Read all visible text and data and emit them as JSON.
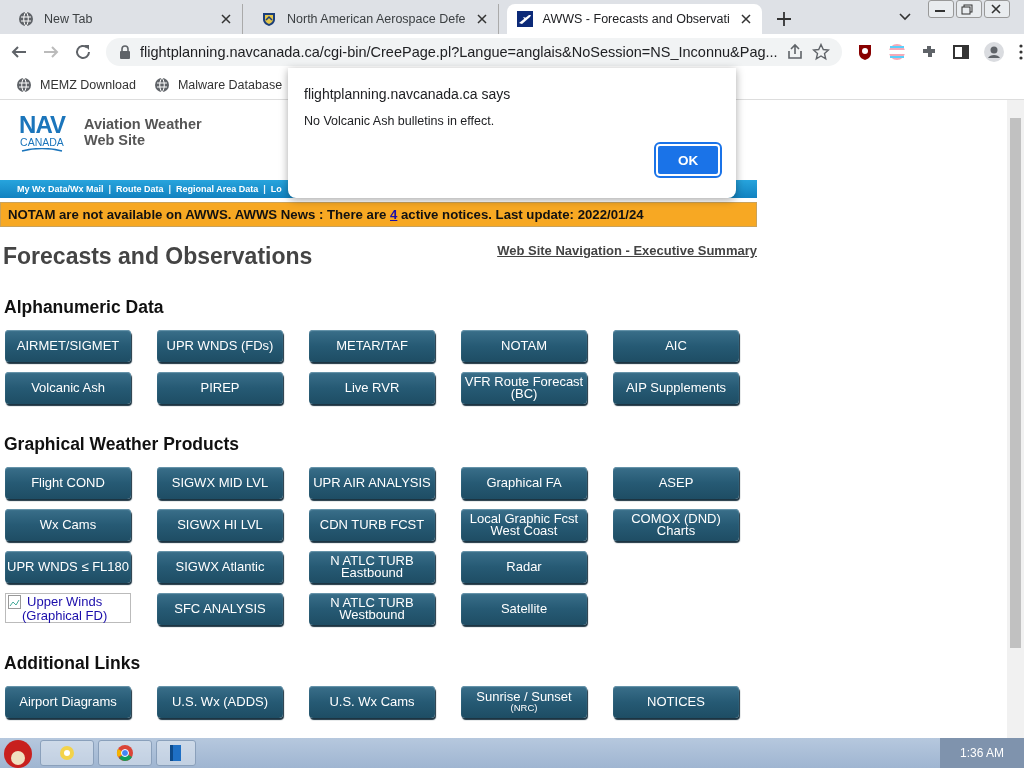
{
  "browser": {
    "tabs": [
      {
        "title": "New Tab",
        "selected": false
      },
      {
        "title": "North American Aerospace Defe",
        "selected": false
      },
      {
        "title": "AWWS - Forecasts and Observati",
        "selected": true
      }
    ],
    "address": "flightplanning.navcanada.ca/cgi-bin/CreePage.pl?Langue=anglais&NoSession=NS_Inconnu&Pag...",
    "bookmarks": [
      "MEMZ Download",
      "Malware Database"
    ]
  },
  "site": {
    "logo_top": "NAV",
    "logo_bottom": "CANADA",
    "name": [
      "Aviation Weather",
      "Web Site"
    ],
    "nav_links": [
      "My Wx Data/Wx Mail",
      "Route Data",
      "Regional Area Data",
      "Lo"
    ],
    "nav_separators": [
      "|",
      "|",
      "|"
    ],
    "notice": {
      "before": "NOTAM are not available on AWWS. AWWS News : There are ",
      "link": "4",
      "after": " active notices. Last update: 2022/01/24"
    }
  },
  "page": {
    "title": "Forecasts and Observations",
    "top_link": "Web Site Navigation - Executive Summary",
    "sections": [
      {
        "heading": "Alphanumeric Data",
        "buttons": [
          {
            "kind": "button",
            "lines": [
              "AIRMET/SIGMET"
            ]
          },
          {
            "kind": "button",
            "lines": [
              "UPR WNDS (FDs)"
            ]
          },
          {
            "kind": "button",
            "lines": [
              "METAR/TAF"
            ]
          },
          {
            "kind": "button",
            "lines": [
              "NOTAM"
            ]
          },
          {
            "kind": "button",
            "lines": [
              "AIC"
            ]
          },
          {
            "kind": "button",
            "lines": [
              "Volcanic Ash"
            ]
          },
          {
            "kind": "button",
            "lines": [
              "PIREP"
            ]
          },
          {
            "kind": "button",
            "lines": [
              "Live RVR"
            ]
          },
          {
            "kind": "button",
            "lines": [
              "VFR Route Forecast",
              "(BC)"
            ]
          },
          {
            "kind": "button",
            "lines": [
              "AIP Supplements"
            ]
          }
        ]
      },
      {
        "heading": "Graphical Weather Products",
        "buttons": [
          {
            "kind": "button",
            "lines": [
              "Flight COND"
            ]
          },
          {
            "kind": "button",
            "lines": [
              "SIGWX MID LVL"
            ]
          },
          {
            "kind": "button",
            "lines": [
              "UPR AIR ANALYSIS"
            ]
          },
          {
            "kind": "button",
            "lines": [
              "Graphical FA"
            ]
          },
          {
            "kind": "button",
            "lines": [
              "ASEP"
            ]
          },
          {
            "kind": "button",
            "lines": [
              "Wx Cams"
            ]
          },
          {
            "kind": "button",
            "lines": [
              "SIGWX HI LVL"
            ]
          },
          {
            "kind": "button",
            "lines": [
              "CDN TURB FCST"
            ]
          },
          {
            "kind": "button",
            "lines": [
              "Local Graphic Fcst",
              "West Coast"
            ]
          },
          {
            "kind": "button",
            "lines": [
              "COMOX (DND)",
              "Charts"
            ]
          },
          {
            "kind": "button",
            "lines": [
              "UPR WNDS ≤ FL180"
            ]
          },
          {
            "kind": "button",
            "lines": [
              "SIGWX Atlantic"
            ]
          },
          {
            "kind": "button",
            "lines": [
              "N ATLC TURB",
              "Eastbound"
            ]
          },
          {
            "kind": "button",
            "lines": [
              "Radar"
            ]
          },
          {
            "kind": "spacer"
          },
          {
            "kind": "broken-image",
            "lines": [
              "Upper Winds",
              "(Graphical FD)"
            ]
          },
          {
            "kind": "button",
            "lines": [
              "SFC ANALYSIS"
            ]
          },
          {
            "kind": "button",
            "lines": [
              "N ATLC TURB",
              "Westbound"
            ]
          },
          {
            "kind": "button",
            "lines": [
              "Satellite"
            ]
          }
        ]
      },
      {
        "heading": "Additional Links",
        "buttons": [
          {
            "kind": "button",
            "lines": [
              "Airport Diagrams"
            ]
          },
          {
            "kind": "button",
            "lines": [
              "U.S. Wx (ADDS)"
            ]
          },
          {
            "kind": "button",
            "lines": [
              "U.S. Wx Cams"
            ]
          },
          {
            "kind": "button",
            "lines": [
              "Sunrise / Sunset"
            ],
            "note": "(NRC)"
          },
          {
            "kind": "button",
            "lines": [
              "NOTICES"
            ]
          }
        ]
      }
    ]
  },
  "dialog": {
    "origin": "flightplanning.navcanada.ca says",
    "message": "No Volcanic Ash bulletins in effect.",
    "button": "OK"
  },
  "taskbar": {
    "clock": "1:36 AM"
  }
}
